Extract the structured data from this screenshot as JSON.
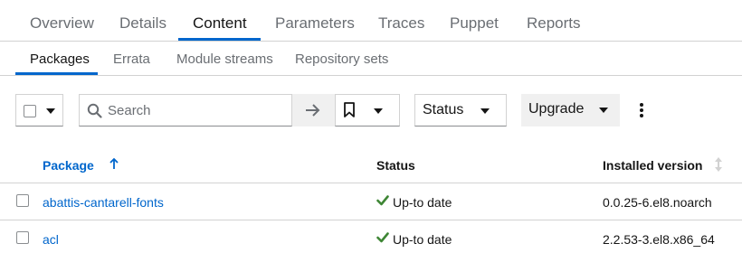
{
  "primary_tabs": [
    "Overview",
    "Details",
    "Content",
    "Parameters",
    "Traces",
    "Puppet",
    "Reports"
  ],
  "secondary_tabs": [
    "Packages",
    "Errata",
    "Module streams",
    "Repository sets"
  ],
  "toolbar": {
    "search_placeholder": "Search",
    "status_label": "Status",
    "upgrade_label": "Upgrade"
  },
  "table": {
    "headers": {
      "package": "Package",
      "status": "Status",
      "installed_version": "Installed version"
    },
    "rows": [
      {
        "package": "abattis-cantarell-fonts",
        "status": "Up-to date",
        "version": "0.0.25-6.el8.noarch"
      },
      {
        "package": "acl",
        "status": "Up-to date",
        "version": "2.2.53-3.el8.x86_64"
      }
    ]
  },
  "colors": {
    "accent": "#0066cc",
    "success": "#3e8635",
    "text": "#151515",
    "muted": "#6a6e73"
  },
  "icons": {
    "search": "search-icon",
    "go": "arrow-right-icon",
    "bookmark": "bookmark-icon",
    "kebab": "kebab-icon",
    "check": "check-icon",
    "sort": "sort-arrow-up-icon"
  }
}
